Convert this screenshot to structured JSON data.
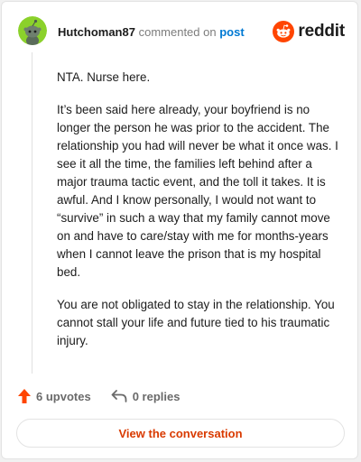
{
  "comment": {
    "username": "Hutchoman87",
    "commented_text": "commented on",
    "post_link": "post",
    "paragraphs": [
      "NTA. Nurse here.",
      "It’s been said here already, your boyfriend is no longer the person he was prior to the accident. The relationship you had will never be what it once was. I see it all the time, the families left behind after a major trauma tactic event, and the toll it takes. It is awful. And I know personally, I would not want to “survive” in such a way that my family cannot move on and have to care/stay with me for months-years when I cannot leave the prison that is my hospital bed.",
      "You are not obligated to stay in the relationship. You cannot stall your life and future tied to his traumatic injury."
    ]
  },
  "brand": {
    "logo_text": "reddit",
    "icon": "reddit-snoo-icon",
    "color": "#ff4500"
  },
  "actions": {
    "upvotes": "6 upvotes",
    "replies": "0 replies",
    "upvote_icon": "upvote-arrow-icon",
    "reply_icon": "reply-arrow-icon",
    "upvote_color": "#ff4500"
  },
  "footer": {
    "button_label": "View the conversation",
    "button_color": "#d93a00"
  },
  "avatar": {
    "background": "#7ed321",
    "icon": "snoo-avatar-icon"
  }
}
